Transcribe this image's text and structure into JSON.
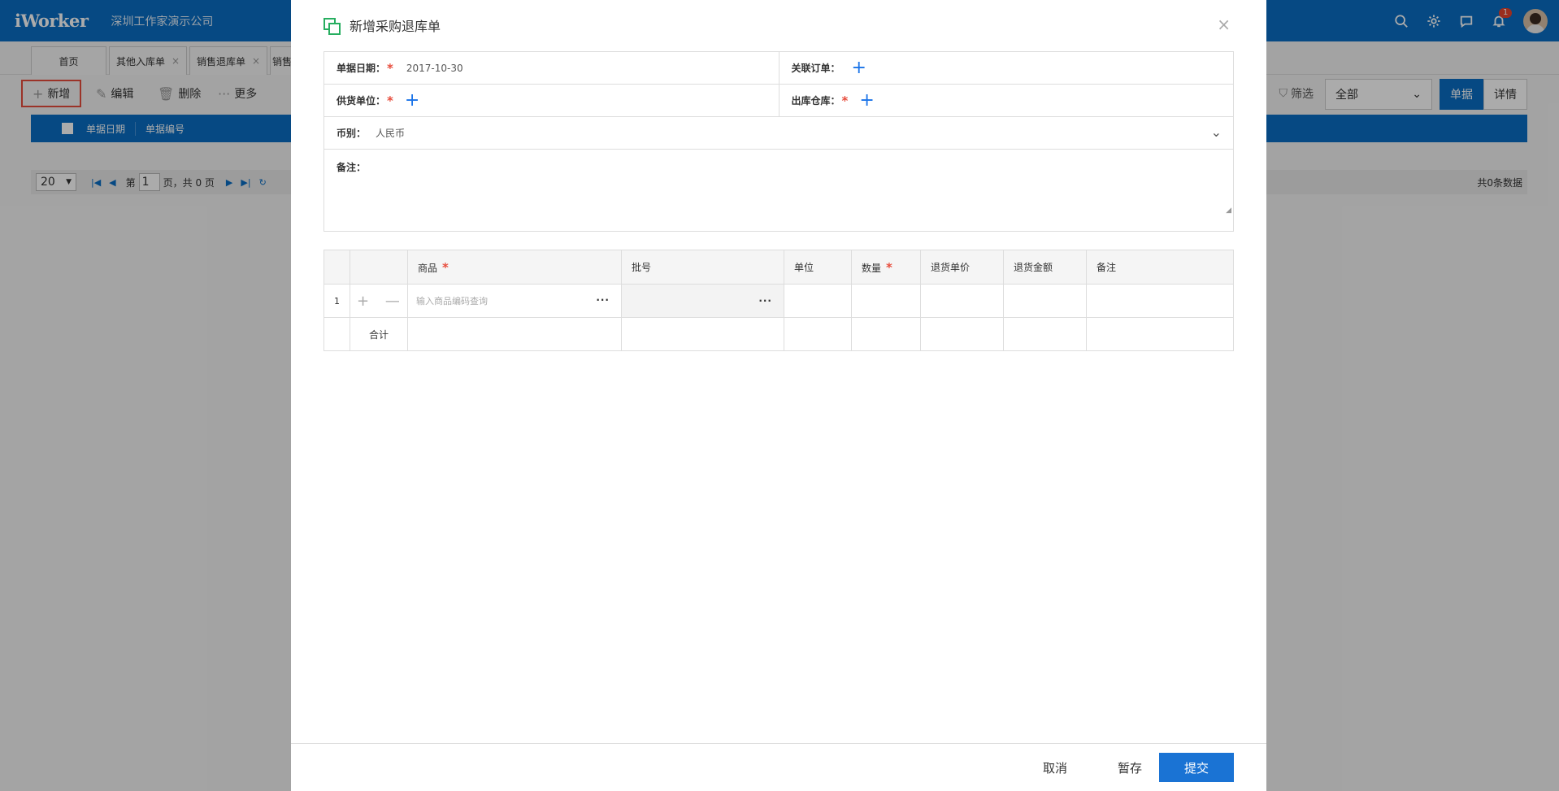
{
  "header": {
    "logo": "iWorker",
    "company": "深圳工作家演示公司",
    "notification_count": "1"
  },
  "page_tabs": [
    {
      "label": "首页"
    },
    {
      "label": "其他入库单"
    },
    {
      "label": "销售退库单"
    },
    {
      "label": "销售"
    }
  ],
  "toolbar": {
    "add_label": "新增",
    "edit_label": "编辑",
    "delete_label": "删除",
    "more_label": "更多",
    "filter_label": "筛选",
    "scope_value": "全部",
    "view_doc_label": "单据",
    "view_detail_label": "详情"
  },
  "grid": {
    "col_date": "单据日期",
    "col_no": "单据编号"
  },
  "pager": {
    "page_size": "20",
    "page_prefix": "第",
    "page_value": "1",
    "page_suffix": "页，共 0 页",
    "total": "共0条数据"
  },
  "modal": {
    "title": "新增采购退库单",
    "fields": {
      "date_label": "单据日期：",
      "date_value": "2017-10-30",
      "order_label": "关联订单：",
      "supplier_label": "供货单位：",
      "warehouse_label": "出库仓库：",
      "currency_label": "币别：",
      "currency_value": "人民币",
      "remark_label": "备注："
    },
    "table": {
      "headers": {
        "product": "商品",
        "batch": "批号",
        "unit": "单位",
        "qty": "数量",
        "price": "退货单价",
        "amount": "退货金额",
        "remark": "备注"
      },
      "row_index": "1",
      "product_placeholder": "输入商品编码查询",
      "total_label": "合计"
    },
    "footer": {
      "cancel": "取消",
      "save_draft": "暂存",
      "submit": "提交"
    }
  },
  "colors": {
    "brand": "#0a6ec4",
    "required": "#e74c3c",
    "submit": "#1a73d4"
  }
}
